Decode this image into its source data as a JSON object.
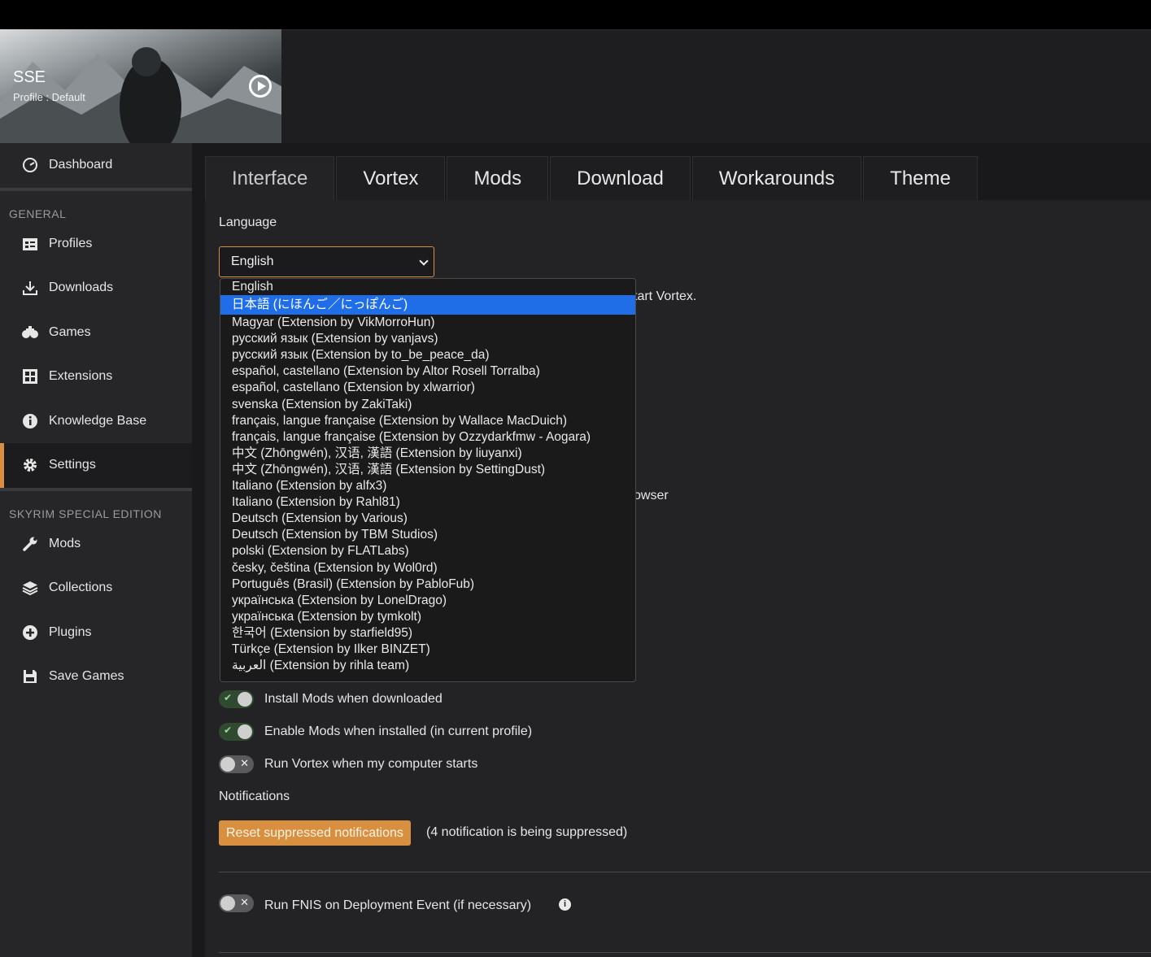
{
  "game": {
    "title": "SSE",
    "profile": "Profile : Default"
  },
  "sidebar": {
    "dashboard": "Dashboard",
    "section_general": "GENERAL",
    "general_items": [
      "Profiles",
      "Downloads",
      "Games",
      "Extensions",
      "Knowledge Base",
      "Settings"
    ],
    "section_game": "SKYRIM SPECIAL EDITION",
    "game_items": [
      "Mods",
      "Collections",
      "Plugins",
      "Save Games"
    ]
  },
  "tabs": [
    "Interface",
    "Vortex",
    "Mods",
    "Download",
    "Workarounds",
    "Theme"
  ],
  "settings": {
    "language_label": "Language",
    "language_value": "English",
    "hint_restart": "tart Vortex.",
    "hint_browser": "owser",
    "install_mods": "Install Mods when downloaded",
    "enable_mods": "Enable Mods when installed (in current profile)",
    "run_vortex": "Run Vortex when my computer starts",
    "notifications_label": "Notifications",
    "reset_button": "Reset suppressed notifications",
    "suppressed_text": "(4 notification is being suppressed)",
    "fnis": "Run FNIS on Deployment Event (if necessary)"
  },
  "language_options": [
    "English",
    "日本語 (にほんご／にっぽんご)",
    "Magyar (Extension by VikMorroHun)",
    "русский язык (Extension by vanjavs)",
    "русский язык (Extension by to_be_peace_da)",
    "español, castellano (Extension by Altor Rosell Torralba)",
    "español, castellano (Extension by xlwarrior)",
    "svenska (Extension by ZakiTaki)",
    "français, langue française (Extension by Wallace MacDuich)",
    "français, langue française (Extension by Ozzydarkfmw - Aogara)",
    "中文 (Zhōngwén), 汉语, 漢語 (Extension by liuyanxi)",
    "中文 (Zhōngwén), 汉语, 漢語 (Extension by SettingDust)",
    "Italiano (Extension by alfx3)",
    "Italiano (Extension by Rahl81)",
    "Deutsch (Extension by Various)",
    "Deutsch (Extension by TBM Studios)",
    "polski (Extension by FLATLabs)",
    "česky, čeština (Extension by Wol0rd)",
    "Português (Brasil) (Extension by PabloFub)",
    "українська (Extension by LonelDrago)",
    "українська (Extension by tymkolt)",
    "한국어 (Extension by starfield95)",
    "Türkçe (Extension by Ilker BINZET)",
    "العربية (Extension by rihla team)"
  ],
  "selected_option_index": 1,
  "toggles": {
    "install_mods": true,
    "enable_mods": true,
    "run_vortex": false,
    "fnis": false
  }
}
